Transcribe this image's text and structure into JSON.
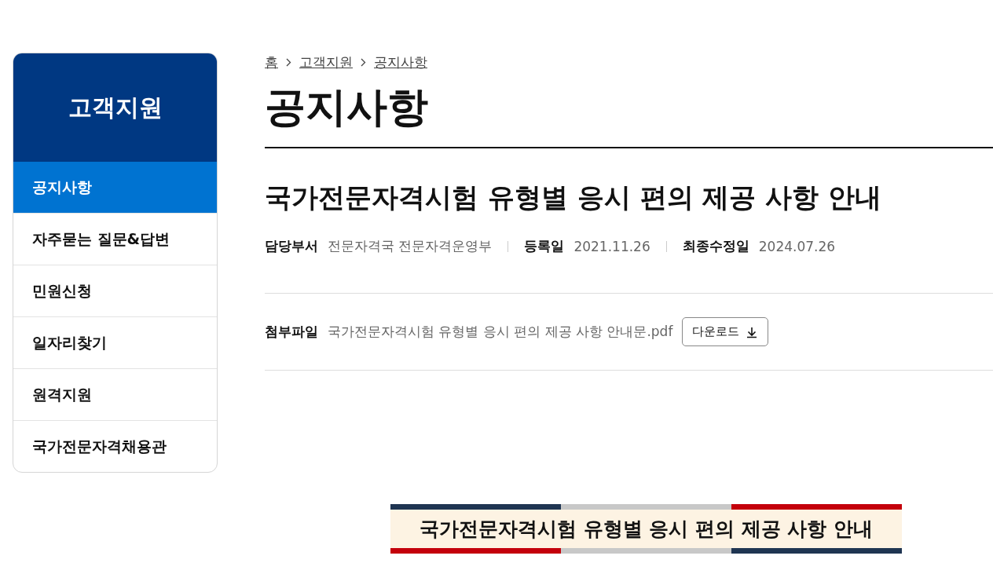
{
  "sidebar": {
    "title": "고객지원",
    "items": [
      {
        "label": "공지사항",
        "selected": true
      },
      {
        "label": "자주묻는 질문&답변",
        "selected": false
      },
      {
        "label": "민원신청",
        "selected": false
      },
      {
        "label": "일자리찾기",
        "selected": false
      },
      {
        "label": "원격지원",
        "selected": false
      },
      {
        "label": "국가전문자격채용관",
        "selected": false
      }
    ]
  },
  "breadcrumb": [
    "홈",
    "고객지원",
    "공지사항"
  ],
  "page_title": "공지사항",
  "article": {
    "title": "국가전문자격시험 유형별 응시 편의 제공 사항 안내",
    "meta": [
      {
        "label": "담당부서",
        "value": "전문자격국 전문자격운영부"
      },
      {
        "label": "등록일",
        "value": "2021.11.26"
      },
      {
        "label": "최종수정일",
        "value": "2024.07.26"
      }
    ],
    "attachment": {
      "label": "첨부파일",
      "filename": "국가전문자격시험 유형별 응시 편의 제공 사항 안내문.pdf",
      "button": "다운로드"
    },
    "banner": {
      "text": "국가전문자격시험 유형별 응시 편의 제공 사항 안내"
    }
  }
}
